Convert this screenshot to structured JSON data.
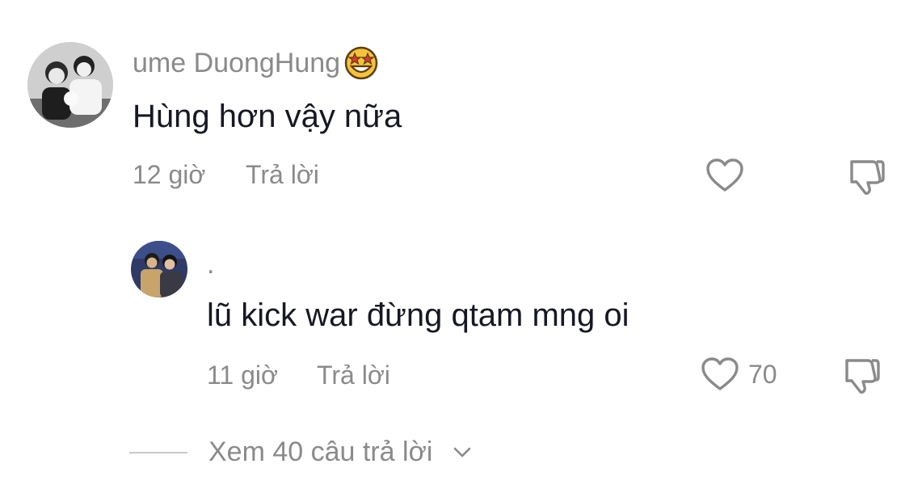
{
  "comments": [
    {
      "username": "ume DuongHung",
      "username_emoji": "star-struck-emoji",
      "text": "Hùng hơn vậy nữa",
      "time": "12 giờ",
      "reply_label": "Trả lời",
      "likes": "",
      "avatar": "avatar-photo-two-people-grayscale"
    },
    {
      "username": ".",
      "text": "lũ kick war đừng qtam mng oi",
      "time": "11 giờ",
      "reply_label": "Trả lời",
      "likes": "70",
      "avatar": "avatar-photo-two-people-stage"
    }
  ],
  "view_replies": {
    "label": "Xem 40 câu trả lời",
    "icon": "chevron-down-icon"
  },
  "icons": {
    "like": "heart-outline-icon",
    "dislike": "thumbs-down-outline-icon"
  },
  "colors": {
    "primary_text": "#161823",
    "secondary_text": "#8a8a8a",
    "background": "#ffffff"
  }
}
